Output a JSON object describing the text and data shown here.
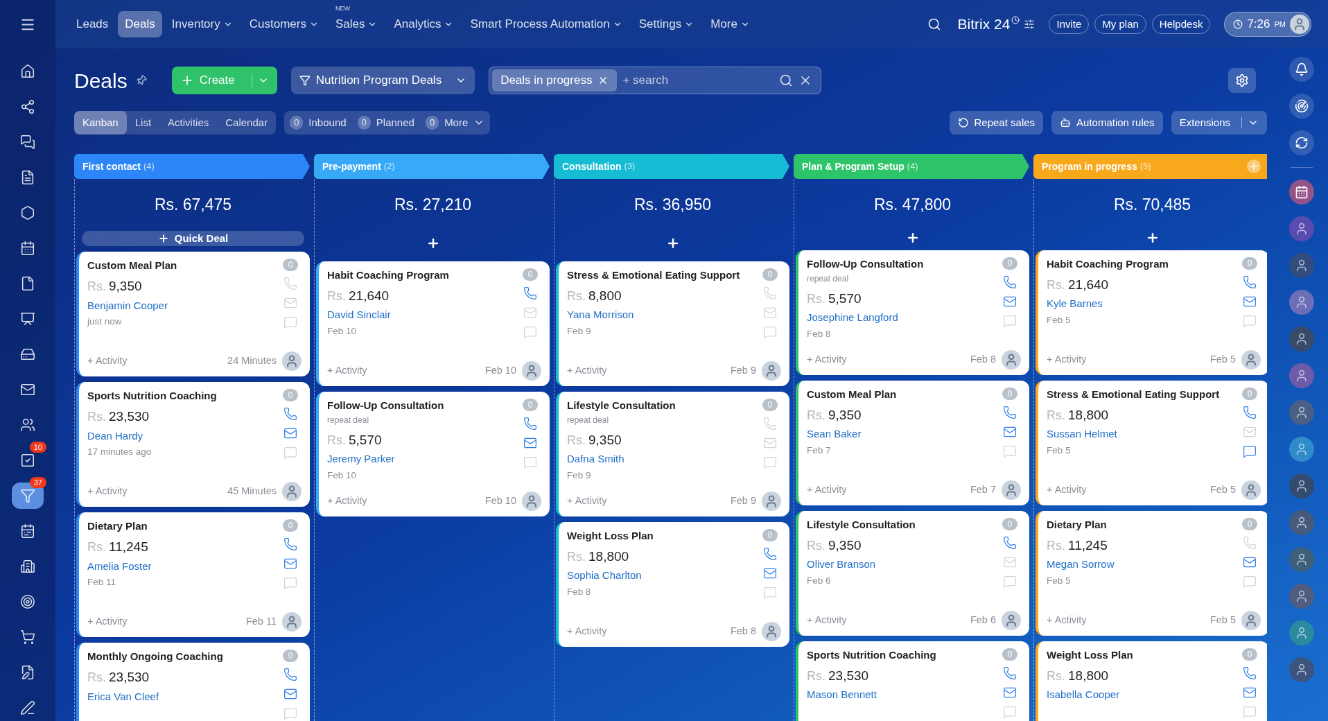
{
  "nav": {
    "items": [
      {
        "label": "Leads",
        "selected": false,
        "dropdown": false
      },
      {
        "label": "Deals",
        "selected": true,
        "dropdown": false
      },
      {
        "label": "Inventory",
        "selected": false,
        "dropdown": true
      },
      {
        "label": "Customers",
        "selected": false,
        "dropdown": true
      },
      {
        "label": "Sales",
        "selected": false,
        "dropdown": true,
        "badge": "NEW"
      },
      {
        "label": "Analytics",
        "selected": false,
        "dropdown": true
      },
      {
        "label": "Smart Process Automation",
        "selected": false,
        "dropdown": true
      },
      {
        "label": "Settings",
        "selected": false,
        "dropdown": true
      },
      {
        "label": "More",
        "selected": false,
        "dropdown": true
      }
    ],
    "logo": "Bitrix 24",
    "buttons": [
      "Invite",
      "My plan",
      "Helpdesk"
    ],
    "time": "7:26",
    "ampm": "PM"
  },
  "sidebar": {
    "items": [
      {
        "kind": "home",
        "selected": false
      },
      {
        "kind": "network",
        "selected": false
      },
      {
        "kind": "chat",
        "selected": false
      },
      {
        "kind": "document",
        "selected": false
      },
      {
        "kind": "hexagon",
        "selected": false
      },
      {
        "kind": "calendar",
        "selected": false
      },
      {
        "kind": "file",
        "selected": false
      },
      {
        "kind": "presentation",
        "selected": false
      },
      {
        "kind": "drive",
        "selected": false
      },
      {
        "kind": "mail",
        "selected": false
      },
      {
        "kind": "users",
        "selected": false
      },
      {
        "kind": "tasks",
        "selected": false,
        "badge": "10"
      },
      {
        "kind": "funnel",
        "selected": true,
        "badge": "37"
      },
      {
        "kind": "calendar-grid",
        "selected": false
      },
      {
        "kind": "building",
        "selected": false
      },
      {
        "kind": "target",
        "selected": false
      },
      {
        "kind": "cart",
        "selected": false
      },
      {
        "kind": "file-edit",
        "selected": false
      },
      {
        "kind": "pen",
        "selected": false
      }
    ]
  },
  "header": {
    "title": "Deals",
    "create": "Create",
    "category": "Nutrition Program Deals",
    "filter_chip": "Deals in progress",
    "search_placeholder": "+ search"
  },
  "views": [
    {
      "label": "Kanban",
      "selected": true
    },
    {
      "label": "List",
      "selected": false
    },
    {
      "label": "Activities",
      "selected": false
    },
    {
      "label": "Calendar",
      "selected": false
    }
  ],
  "counters": [
    {
      "count": "0",
      "label": "Inbound"
    },
    {
      "count": "0",
      "label": "Planned"
    },
    {
      "count": "0",
      "label": "More"
    }
  ],
  "actions": [
    "Repeat sales",
    "Automation rules",
    "Extensions"
  ],
  "columns": [
    {
      "name": "First contact",
      "count": "(4)",
      "color": "#2d86f7",
      "total": "Rs. 67,475",
      "add_label": "Quick Deal",
      "cards": [
        {
          "title": "Custom Meal Plan",
          "currency": "Rs.",
          "amount": "9,350",
          "contact": "Benjamin Cooper",
          "date": "just now",
          "activity": "+ Activity",
          "time": "24 Minutes",
          "counter": "0",
          "phone": false,
          "mail": false,
          "chat": false
        },
        {
          "title": "Sports Nutrition Coaching",
          "currency": "Rs.",
          "amount": "23,530",
          "contact": "Dean Hardy",
          "date": "17 minutes ago",
          "activity": "+ Activity",
          "time": "45 Minutes",
          "counter": "0",
          "phone": true,
          "mail": true,
          "chat": false
        },
        {
          "title": "Dietary Plan",
          "currency": "Rs.",
          "amount": "11,245",
          "contact": "Amelia Foster",
          "date": "Feb 11",
          "activity": "+ Activity",
          "time": "Feb 11",
          "counter": "0",
          "phone": true,
          "mail": true,
          "chat": false
        },
        {
          "title": "Monthly Ongoing Coaching",
          "currency": "Rs.",
          "amount": "23,530",
          "contact": "Erica Van Cleef",
          "counter": "0",
          "phone": true,
          "mail": true,
          "chat": false
        }
      ]
    },
    {
      "name": "Pre-payment",
      "count": "(2)",
      "color": "#38a9f6",
      "total": "Rs. 27,210",
      "cards": [
        {
          "title": "Habit Coaching Program",
          "currency": "Rs.",
          "amount": "21,640",
          "contact": "David Sinclair",
          "date": "Feb 10",
          "activity": "+ Activity",
          "time": "Feb 10",
          "counter": "0",
          "phone": true,
          "mail": false,
          "chat": false
        },
        {
          "title": "Follow-Up Consultation",
          "note": "repeat deal",
          "currency": "Rs.",
          "amount": "5,570",
          "contact": "Jeremy Parker",
          "date": "Feb 10",
          "activity": "+ Activity",
          "time": "Feb 10",
          "counter": "0",
          "phone": true,
          "mail": true,
          "chat": false
        }
      ]
    },
    {
      "name": "Consultation",
      "count": "(3)",
      "color": "#16bcd3",
      "total": "Rs. 36,950",
      "cards": [
        {
          "title": "Stress & Emotional Eating Support",
          "currency": "Rs.",
          "amount": "8,800",
          "contact": "Yana Morrison",
          "date": "Feb 9",
          "activity": "+ Activity",
          "time": "Feb 9",
          "counter": "0",
          "phone": false,
          "mail": false,
          "chat": false
        },
        {
          "title": "Lifestyle Consultation",
          "note": "repeat deal",
          "currency": "Rs.",
          "amount": "9,350",
          "contact": "Dafna Smith",
          "date": "Feb 9",
          "activity": "+ Activity",
          "time": "Feb 9",
          "counter": "0",
          "phone": false,
          "mail": false,
          "chat": false
        },
        {
          "title": "Weight Loss Plan",
          "currency": "Rs.",
          "amount": "18,800",
          "contact": "Sophia Charlton",
          "date": "Feb 8",
          "activity": "+ Activity",
          "time": "Feb 8",
          "counter": "0",
          "phone": true,
          "mail": true,
          "chat": false
        }
      ]
    },
    {
      "name": "Plan & Program Setup",
      "count": "(4)",
      "color": "#2ec46a",
      "total": "Rs. 47,800",
      "cards": [
        {
          "title": "Follow-Up Consultation",
          "note": "repeat deal",
          "currency": "Rs.",
          "amount": "5,570",
          "contact": "Josephine Langford",
          "date": "Feb 8",
          "activity": "+ Activity",
          "time": "Feb 8",
          "counter": "0",
          "phone": true,
          "mail": true,
          "chat": false
        },
        {
          "title": "Custom Meal Plan",
          "currency": "Rs.",
          "amount": "9,350",
          "contact": "Sean Baker",
          "date": "Feb 7",
          "activity": "+ Activity",
          "time": "Feb 7",
          "counter": "0",
          "phone": true,
          "mail": true,
          "chat": false
        },
        {
          "title": "Lifestyle Consultation",
          "currency": "Rs.",
          "amount": "9,350",
          "contact": "Oliver Branson",
          "date": "Feb 6",
          "activity": "+ Activity",
          "time": "Feb 6",
          "counter": "0",
          "phone": true,
          "mail": false,
          "chat": false
        },
        {
          "title": "Sports Nutrition Coaching",
          "currency": "Rs.",
          "amount": "23,530",
          "contact": "Mason Bennett",
          "counter": "0",
          "phone": true,
          "mail": true,
          "chat": false
        }
      ]
    },
    {
      "name": "Program in progress",
      "count": "(5)",
      "color": "#f7a81b",
      "total": "Rs. 70,485",
      "cards": [
        {
          "title": "Habit Coaching Program",
          "currency": "Rs.",
          "amount": "21,640",
          "contact": "Kyle Barnes",
          "date": "Feb 5",
          "activity": "+ Activity",
          "time": "Feb 5",
          "counter": "0",
          "phone": true,
          "mail": true,
          "chat": false
        },
        {
          "title": "Stress & Emotional Eating Support",
          "currency": "Rs.",
          "amount": "18,800",
          "contact": "Sussan Helmet",
          "date": "Feb 5",
          "activity": "+ Activity",
          "time": "Feb 5",
          "counter": "0",
          "phone": true,
          "mail": false,
          "chat": true
        },
        {
          "title": "Dietary Plan",
          "currency": "Rs.",
          "amount": "11,245",
          "contact": "Megan Sorrow",
          "date": "Feb 5",
          "activity": "+ Activity",
          "time": "Feb 5",
          "counter": "0",
          "phone": false,
          "mail": true,
          "chat": false
        },
        {
          "title": "Weight Loss Plan",
          "currency": "Rs.",
          "amount": "18,800",
          "contact": "Isabella Cooper",
          "counter": "0",
          "phone": true,
          "mail": true,
          "chat": false
        }
      ]
    }
  ]
}
